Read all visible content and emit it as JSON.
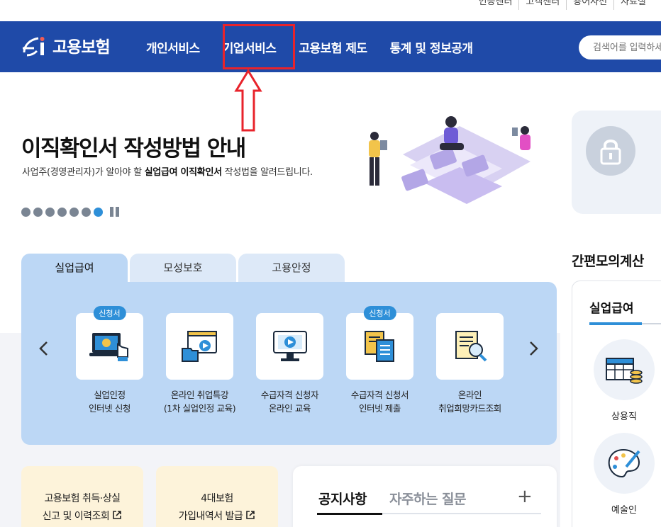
{
  "util_links": [
    "인증센터",
    "고객센터",
    "용어사전",
    "자료실"
  ],
  "logo": {
    "text": "고용보험"
  },
  "nav": {
    "items": [
      "개인서비스",
      "기업서비스",
      "고용보험 제도",
      "통계 및 정보공개"
    ]
  },
  "search": {
    "placeholder": "검색어를 입력하세요"
  },
  "hero": {
    "title": "이직확인서 작성방법 안내",
    "sub_pre": "사업주(경영관리자)가 알아야 할 ",
    "sub_bold": "실업급여 이직확인서",
    "sub_post": " 작성법을 알려드립니다."
  },
  "tabs": [
    "실업급여",
    "모성보호",
    "고용안정"
  ],
  "services": [
    {
      "badge": "신청서",
      "line1": "실업인정",
      "line2": "인터넷 신청",
      "icon": "laptop-hand-icon"
    },
    {
      "badge": "",
      "line1": "온라인 취업특강",
      "line2": "(1차 실업인정 교육)",
      "icon": "video-folder-icon"
    },
    {
      "badge": "",
      "line1": "수급자격 신청자",
      "line2": "온라인 교육",
      "icon": "monitor-play-icon"
    },
    {
      "badge": "신청서",
      "line1": "수급자격 신청서",
      "line2": "인터넷 제출",
      "icon": "documents-icon"
    },
    {
      "badge": "",
      "line1": "온라인",
      "line2": "취업희망카드조회",
      "icon": "document-search-icon"
    }
  ],
  "bottom_cards": [
    {
      "line1": "고용보험 취득·상실",
      "line2": "신고 및 이력조회"
    },
    {
      "line1": "4대보험",
      "line2": "가입내역서 발급"
    }
  ],
  "notice": {
    "tab1": "공지사항",
    "tab2": "자주하는 질문",
    "more": "+"
  },
  "calc": {
    "title": "간편모의계산",
    "tab": "실업급여",
    "items": [
      "상용직",
      "예술인"
    ]
  }
}
